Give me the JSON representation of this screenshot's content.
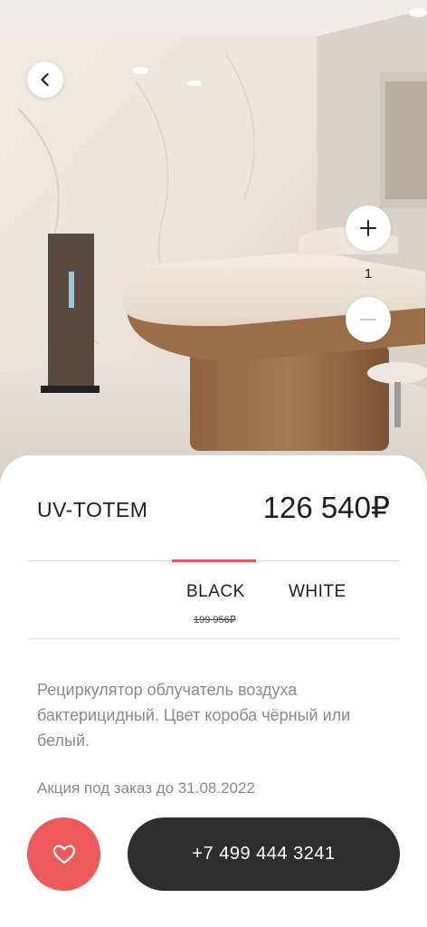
{
  "hero": {
    "back_icon": "chevron-left-icon",
    "zoom_in_icon": "plus-icon",
    "zoom_out_icon": "minus-icon",
    "quantity": "1"
  },
  "product": {
    "name": "UV-TOTEM",
    "price": "126 540₽",
    "old_price": "199 956₽",
    "description": "Рециркулятор облучатель воздуха бактерицидный. Цвет короба чёрный или белый.",
    "promo": "Акция под заказ до 31.08.2022"
  },
  "tabs": [
    {
      "label": "BLACK",
      "active": true
    },
    {
      "label": "WHITE",
      "active": false
    }
  ],
  "actions": {
    "favorite_icon": "heart-icon",
    "phone": "+7 499 444 3241"
  },
  "colors": {
    "accent": "#ed5a5a",
    "dark_button": "#2e2e2e",
    "muted_text": "#8a8a8a"
  }
}
